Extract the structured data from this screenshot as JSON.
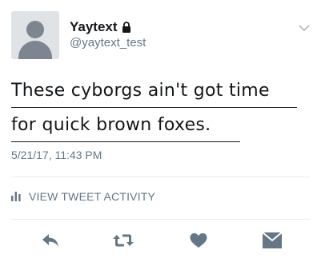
{
  "user": {
    "display_name": "Yaytext",
    "handle": "@yaytext_test",
    "protected": true
  },
  "tweet": {
    "line1": "These cyborgs ain't got time",
    "line2": "for quick brown foxes.",
    "timestamp": "5/21/17, 11:43 PM"
  },
  "activity": {
    "label": "VIEW TWEET ACTIVITY"
  },
  "icons": {
    "lock": "lock-icon",
    "chevron": "chevron-down-icon",
    "bars": "bar-chart-icon",
    "reply": "reply-icon",
    "retweet": "retweet-icon",
    "like": "heart-icon",
    "dm": "direct-message-icon"
  },
  "colors": {
    "text": "#14171a",
    "secondary": "#657786",
    "icon": "#657786",
    "divider": "#e6ecf0",
    "avatar_bg": "#dfe3e6"
  }
}
